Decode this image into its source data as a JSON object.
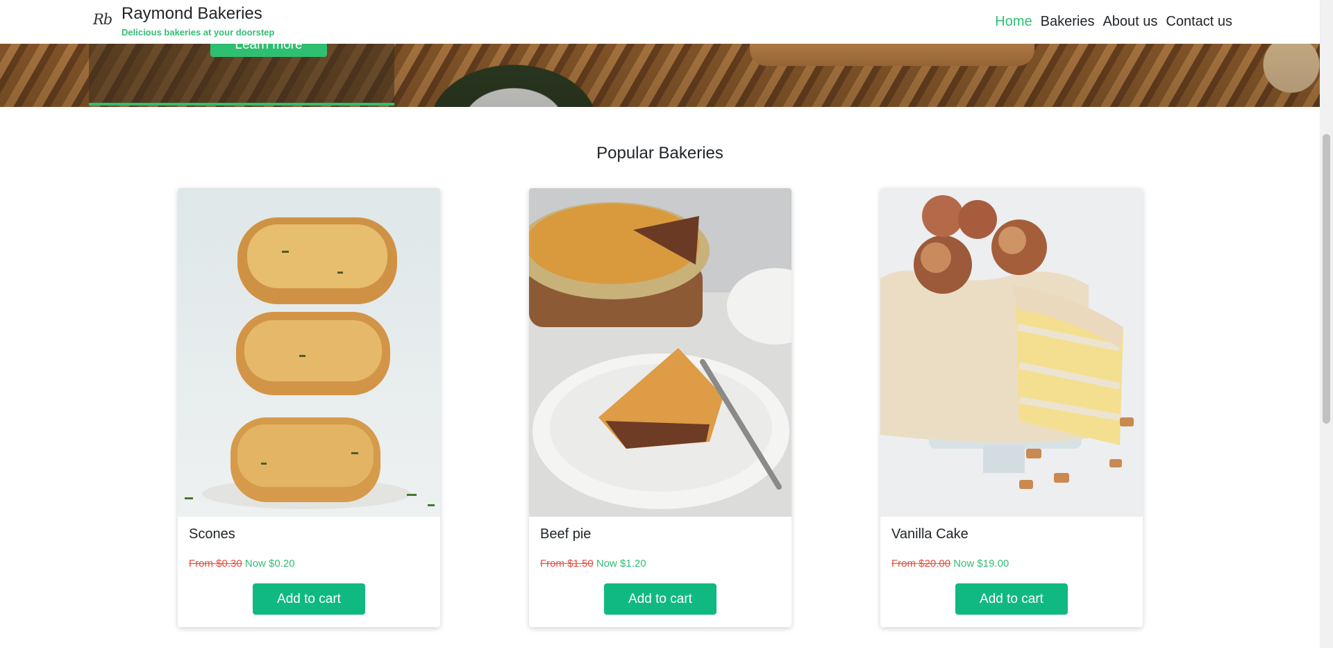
{
  "brand": {
    "logo_text": "Rb",
    "title": "Raymond Bakeries",
    "subtitle": "Delicious bakeries at your doorstep"
  },
  "nav": {
    "items": [
      {
        "label": "Home",
        "active": true
      },
      {
        "label": "Bakeries",
        "active": false
      },
      {
        "label": "About us",
        "active": false
      },
      {
        "label": "Contact us",
        "active": false
      }
    ]
  },
  "hero": {
    "button_label": "Learn more"
  },
  "section": {
    "title": "Popular Bakeries"
  },
  "products": [
    {
      "name": "Scones",
      "old_price": "From $0.30",
      "new_price": "Now $0.20",
      "button_label": "Add to cart"
    },
    {
      "name": "Beef pie",
      "old_price": "From $1.50",
      "new_price": "Now $1.20",
      "button_label": "Add to cart"
    },
    {
      "name": "Vanilla Cake",
      "old_price": "From $20.00",
      "new_price": "Now $19.00",
      "button_label": "Add to cart"
    }
  ],
  "colors": {
    "accent": "#2fbf71",
    "button": "#10b981",
    "old_price": "#e74c3c",
    "text": "#212529"
  }
}
